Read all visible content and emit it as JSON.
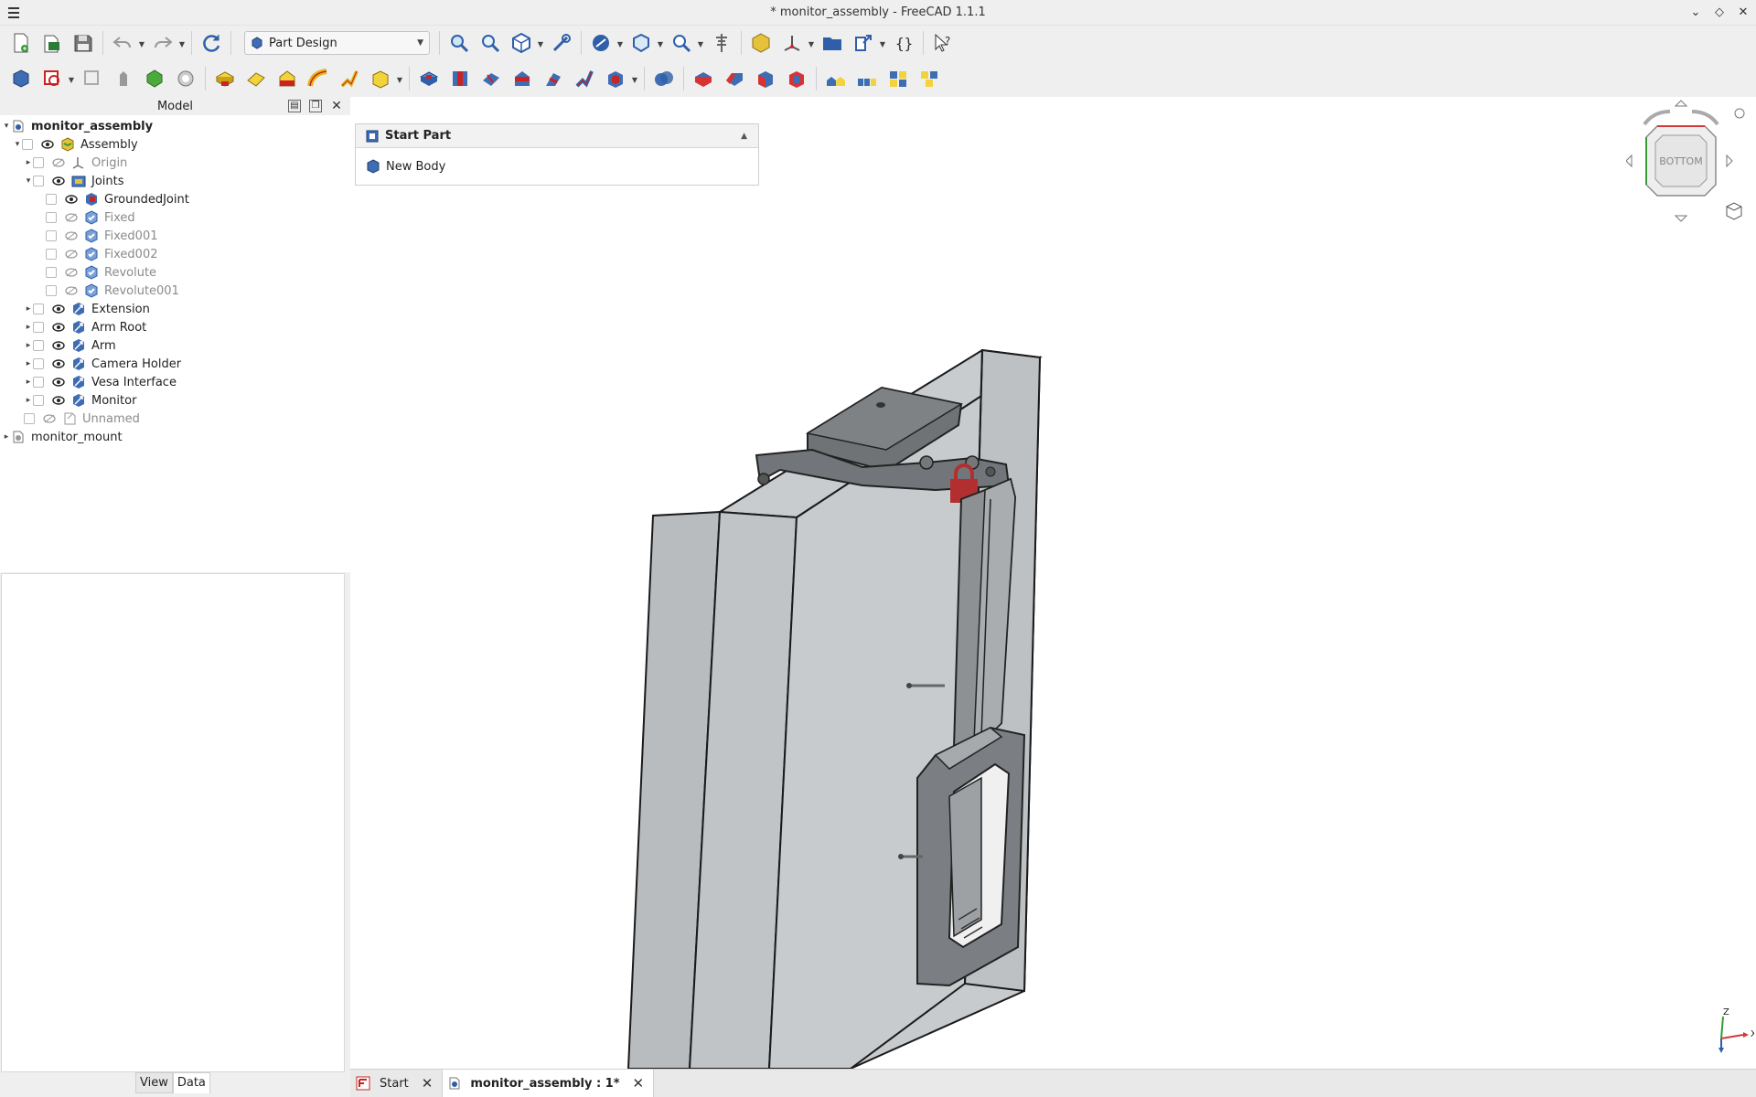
{
  "window": {
    "title": "* monitor_assembly - FreeCAD 1.1.1"
  },
  "toolbar": {
    "workbench": "Part Design"
  },
  "panel": {
    "title": "Model"
  },
  "tree": {
    "root": "monitor_assembly",
    "assembly": "Assembly",
    "origin": "Origin",
    "joints": "Joints",
    "grounded": "GroundedJoint",
    "fixed": "Fixed",
    "fixed001": "Fixed001",
    "fixed002": "Fixed002",
    "revolute": "Revolute",
    "revolute001": "Revolute001",
    "extension": "Extension",
    "arm_root": "Arm Root",
    "arm": "Arm",
    "camera_holder": "Camera Holder",
    "vesa_interface": "Vesa Interface",
    "monitor": "Monitor",
    "unnamed": "Unnamed",
    "monitor_mount": "monitor_mount"
  },
  "property_tabs": {
    "view": "View",
    "data": "Data"
  },
  "task": {
    "title": "Start Part",
    "item": "New Body"
  },
  "navcube": {
    "face": "BOTTOM"
  },
  "axis": {
    "x": "X",
    "z": "Z"
  },
  "doc_tabs": [
    {
      "label": "Start"
    },
    {
      "label": "monitor_assembly : 1*"
    }
  ],
  "colors": {
    "accent": "#2f5fa8",
    "part_grey": "#c6c9cc",
    "lock_red": "#b32f2f"
  }
}
